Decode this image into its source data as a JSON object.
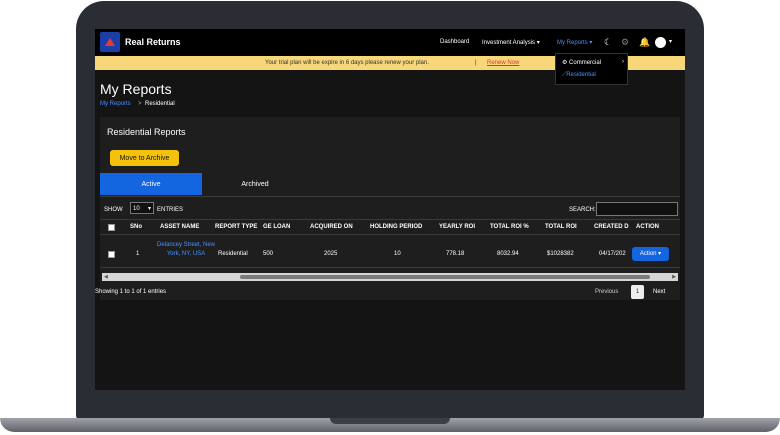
{
  "navbar": {
    "brand": "Real Returns",
    "links": {
      "dashboard": "Dashboard",
      "investment": "Investment Analysis ▾",
      "reports": "My Reports ▾"
    },
    "icons": [
      "moon-icon",
      "gear-icon",
      "bell-icon",
      "user-avatar-icon"
    ]
  },
  "dropdown": {
    "commercial": "Commercial",
    "residential": "Residential"
  },
  "trial": {
    "message": "Your trial plan will be expire in 6 days please renew your plan.",
    "separator": "|",
    "renew": "Renew Now"
  },
  "page": {
    "title": "My Reports",
    "crumb_root": "My Reports",
    "crumb_sep": ">",
    "crumb_current": "Residential"
  },
  "card": {
    "title": "Residential Reports",
    "archive_button": "Move to Archive",
    "tabs": [
      "Active",
      "Archived"
    ],
    "show": "SHOW",
    "entries_value": "10",
    "entries": "ENTRIES",
    "search": "SEARCH:"
  },
  "table": {
    "headers": [
      "SNo",
      "ASSET NAME",
      "REPORT TYPE",
      "GE LOAN",
      "ACQUIRED ON",
      "HOLDING PERIOD",
      "YEARLY ROI",
      "TOTAL ROI %",
      "TOTAL ROI",
      "CREATED D",
      "ACTION"
    ],
    "row": {
      "sno": "1",
      "asset": "Delancey Street, New York, NY, USA",
      "report_type": "Residential",
      "loan": "500",
      "acquired": "2025",
      "holding": "10",
      "yearly_roi": "778.18",
      "total_roi_pct": "8032.94",
      "total_roi": "$1028382",
      "created": "04/17/202",
      "action": "Action ▾"
    }
  },
  "footer": {
    "showing": "Showing 1 to 1 of 1 entries",
    "previous": "Previous",
    "page": "1",
    "next": "Next"
  }
}
